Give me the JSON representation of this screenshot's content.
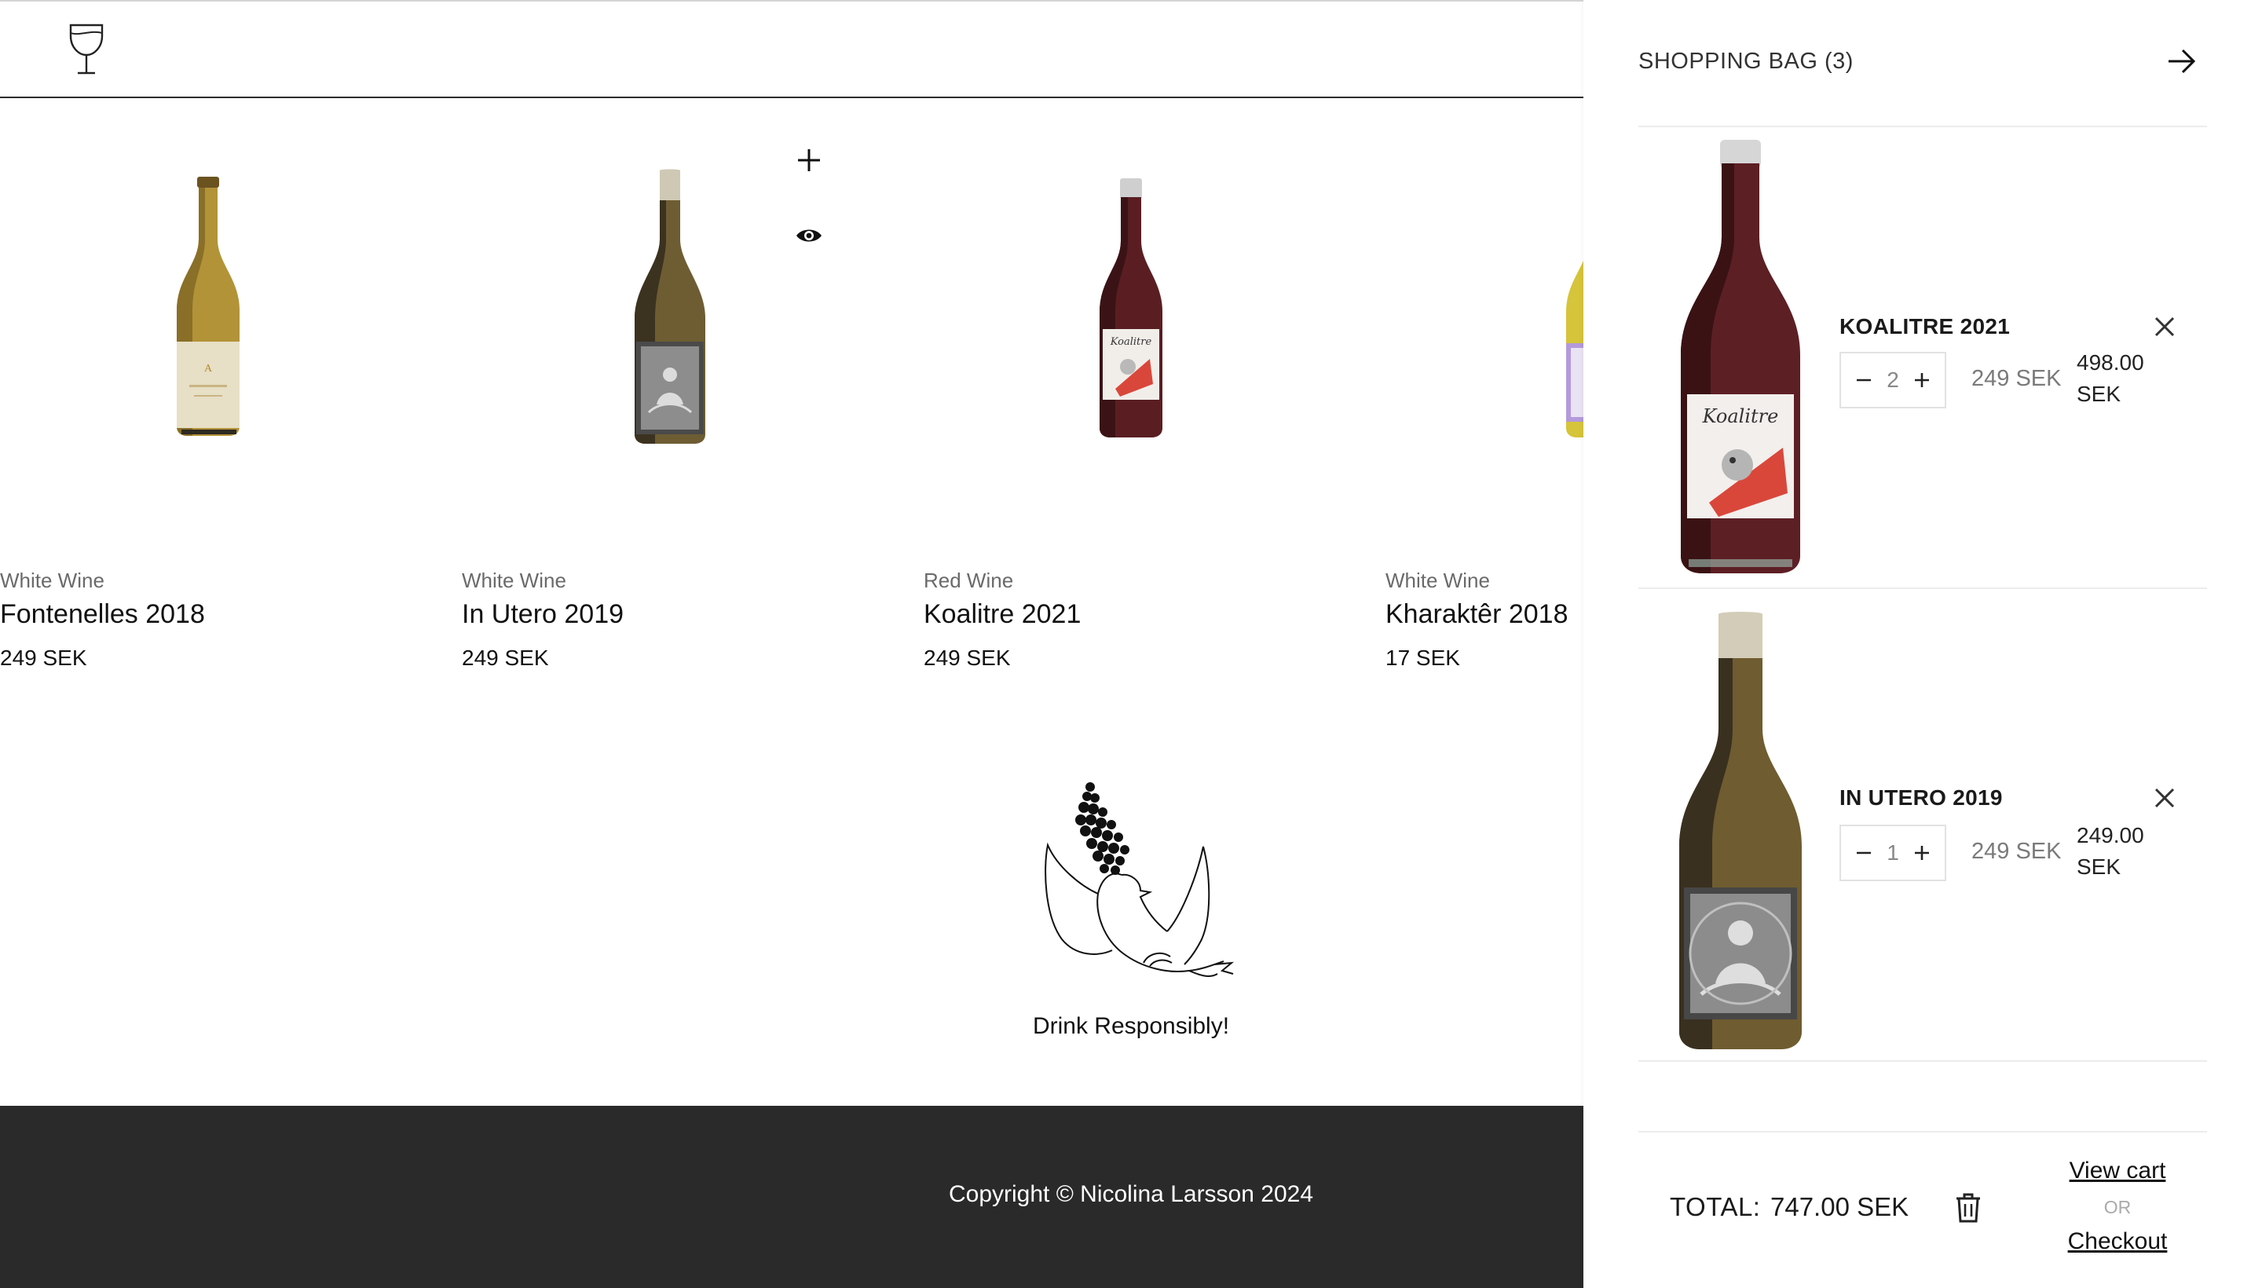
{
  "products": [
    {
      "category": "White Wine",
      "name": "Fontenelles 2018",
      "price": "249 SEK"
    },
    {
      "category": "White Wine",
      "name": "In Utero 2019",
      "price": "249 SEK"
    },
    {
      "category": "Red Wine",
      "name": "Koalitre 2021",
      "price": "249 SEK"
    },
    {
      "category": "White Wine",
      "name": "Kharaktêr 2018",
      "price": "17 SEK"
    }
  ],
  "hover_icons": [
    "plus-icon",
    "eye-icon"
  ],
  "footer": {
    "tagline": "Drink Responsibly!",
    "copyright": "Copyright © Nicolina Larsson 2024"
  },
  "cart": {
    "title": "SHOPPING BAG (3)",
    "items": [
      {
        "name": "KOALITRE 2021",
        "qty": "2",
        "unit_price": "249 SEK",
        "line_total_value": "498.00",
        "line_total_currency": "SEK"
      },
      {
        "name": "IN UTERO 2019",
        "qty": "1",
        "unit_price": "249 SEK",
        "line_total_value": "249.00",
        "line_total_currency": "SEK"
      }
    ],
    "total_label": "TOTAL:",
    "total_value": "747.00 SEK",
    "view_cart": "View cart",
    "or": "OR",
    "checkout": "Checkout"
  },
  "colors": {
    "footer_bg": "#2a2a2a",
    "text": "#1a1a1a",
    "muted": "#7a7a7a",
    "red_wine": "#4a1b1f",
    "white_wine": "#a8882a",
    "orange_wine": "#7a6430"
  }
}
